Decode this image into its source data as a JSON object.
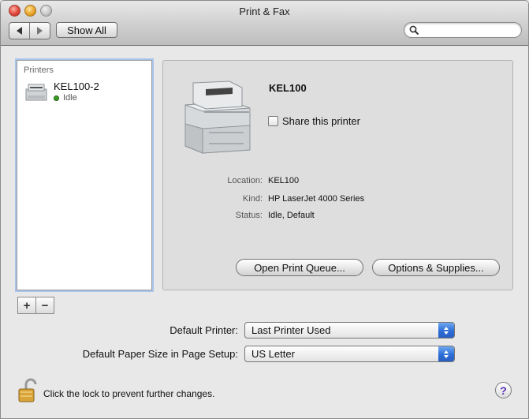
{
  "window": {
    "title": "Print & Fax"
  },
  "toolbar": {
    "show_all_label": "Show All",
    "search_placeholder": ""
  },
  "printers_list": {
    "header": "Printers",
    "items": [
      {
        "name": "KEL100-2",
        "status": "Idle"
      }
    ]
  },
  "printer_detail": {
    "name": "KEL100",
    "share_label": "Share this printer",
    "share_checked": false,
    "location_label": "Location:",
    "location_value": "KEL100",
    "kind_label": "Kind:",
    "kind_value": "HP LaserJet 4000 Series",
    "status_label": "Status:",
    "status_value": "Idle, Default",
    "open_queue_label": "Open Print Queue...",
    "options_label": "Options & Supplies..."
  },
  "list_controls": {
    "add": "+",
    "remove": "−"
  },
  "defaults": {
    "default_printer_label": "Default Printer:",
    "default_printer_value": "Last Printer Used",
    "paper_size_label": "Default Paper Size in Page Setup:",
    "paper_size_value": "US Letter"
  },
  "footer": {
    "lock_text": "Click the lock to prevent further changes.",
    "help_symbol": "?"
  },
  "colors": {
    "status_idle": "#3a9b28",
    "accent_blue": "#2d6ed8",
    "help_purple": "#5a2fb8"
  }
}
